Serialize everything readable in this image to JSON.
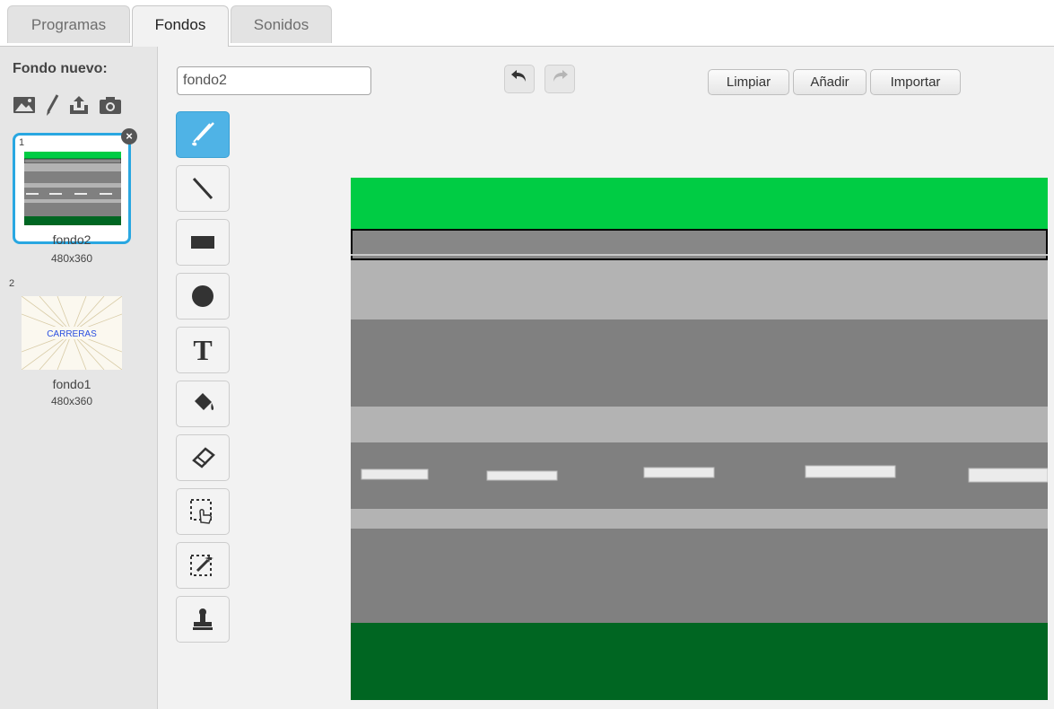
{
  "tabs": [
    {
      "label": "Programas",
      "active": false
    },
    {
      "label": "Fondos",
      "active": true
    },
    {
      "label": "Sonidos",
      "active": false
    }
  ],
  "left_panel": {
    "new_label": "Fondo nuevo:",
    "new_icons": [
      "image-library-icon",
      "paint-brush-icon",
      "upload-icon",
      "camera-icon"
    ],
    "backdrops": [
      {
        "number": "1",
        "name": "fondo2",
        "size": "480x360",
        "selected": true
      },
      {
        "number": "2",
        "name": "fondo1",
        "size": "480x360",
        "selected": false,
        "thumb_text": "CARRERAS"
      }
    ]
  },
  "editor": {
    "costume_name": "fondo2",
    "undo_icon": "undo-icon",
    "redo_icon": "redo-icon",
    "buttons": {
      "clear": "Limpiar",
      "add": "Añadir",
      "import": "Importar"
    },
    "tools": [
      "brush-icon",
      "line-icon",
      "rectangle-icon",
      "ellipse-icon",
      "text-icon",
      "fill-icon",
      "eraser-icon",
      "select-icon",
      "magic-select-icon",
      "stamp-icon"
    ],
    "text_tool_glyph": "T"
  },
  "colors": {
    "accent": "#29a7e1",
    "grass_light": "#00cc44",
    "grass_dark": "#006622",
    "road": "#808080",
    "road_light": "#b3b3b3",
    "lane_mark": "#ebebeb"
  }
}
